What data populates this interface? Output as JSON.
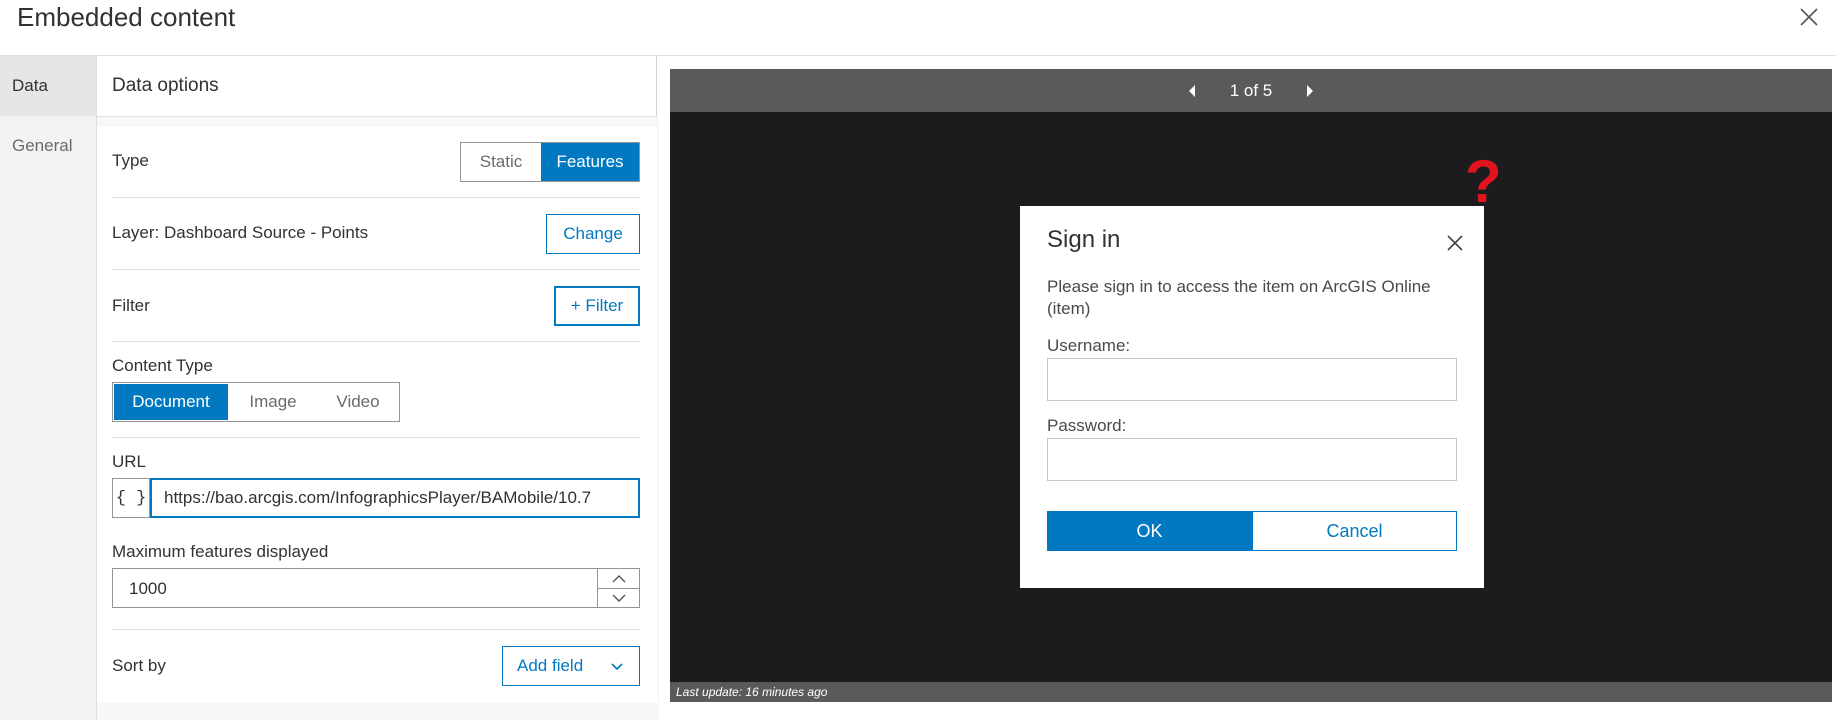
{
  "window": {
    "title": "Embedded content",
    "close_icon": "close-icon"
  },
  "tabs": [
    {
      "label": "Data",
      "active": true
    },
    {
      "label": "General",
      "active": false
    }
  ],
  "panel": {
    "header": "Data options",
    "type": {
      "label": "Type",
      "options": [
        "Static",
        "Features"
      ],
      "selected": "Features"
    },
    "layer": {
      "label": "Layer: Dashboard Source - Points",
      "button": "Change"
    },
    "filter": {
      "label": "Filter",
      "button": "+ Filter"
    },
    "content_type": {
      "label": "Content Type",
      "options": [
        "Document",
        "Image",
        "Video"
      ],
      "selected": "Document"
    },
    "url": {
      "label": "URL",
      "braces": "{ }",
      "value": "https://bao.arcgis.com/InfographicsPlayer/BAMobile/10.7"
    },
    "max_features": {
      "label": "Maximum features displayed",
      "value": "1000"
    },
    "sort_by": {
      "label": "Sort by",
      "button": "Add field"
    }
  },
  "preview": {
    "pager": "1 of 5",
    "last_update": "Last update: 16 minutes ago",
    "annotation": "?"
  },
  "dialog": {
    "title": "Sign in",
    "message": "Please sign in to access the item on ArcGIS Online (item)",
    "username_label": "Username:",
    "password_label": "Password:",
    "ok": "OK",
    "cancel": "Cancel"
  },
  "colors": {
    "accent": "#0079c1",
    "annotation": "#e0141e",
    "preview_bg": "#1c1c1e",
    "preview_bar": "#5a5a5a"
  }
}
